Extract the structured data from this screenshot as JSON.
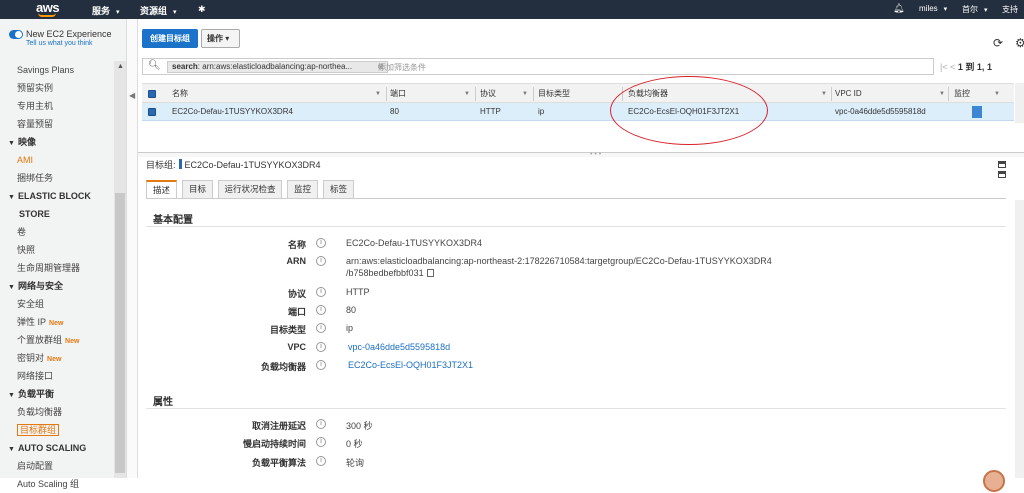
{
  "topnav": {
    "logo": "aws",
    "services": "服务",
    "resource_groups": "资源组",
    "user": "miles",
    "region": "首尔",
    "support": "支持"
  },
  "sidebar": {
    "new_experience_label": "New EC2 Experience",
    "new_experience_sub": "Tell us what you think",
    "items": [
      {
        "label": "Savings Plans"
      },
      {
        "label": "预留实例"
      },
      {
        "label": "专用主机"
      },
      {
        "label": "容量预留"
      },
      {
        "label": "映像",
        "head": true
      },
      {
        "label": "AMI"
      },
      {
        "label": "捆绑任务"
      },
      {
        "label": "ELASTIC BLOCK",
        "head": true
      },
      {
        "label": "STORE",
        "head_cont": true
      },
      {
        "label": "卷"
      },
      {
        "label": "快照"
      },
      {
        "label": "生命周期管理器"
      },
      {
        "label": "网络与安全",
        "head": true
      },
      {
        "label": "安全组"
      },
      {
        "label": "弹性 IP",
        "badge": "New"
      },
      {
        "label": "个置放群组",
        "badge": "New"
      },
      {
        "label": "密钥对",
        "badge": "New"
      },
      {
        "label": "网络接口"
      },
      {
        "label": "负载平衡",
        "head": true
      },
      {
        "label": "负载均衡器"
      },
      {
        "label": "目标群组",
        "active": true
      },
      {
        "label": "AUTO SCALING",
        "head": true
      },
      {
        "label": "启动配置"
      },
      {
        "label": "Auto Scaling 组"
      }
    ]
  },
  "toolbar": {
    "create_label": "创建目标组",
    "actions_label": "操作"
  },
  "search": {
    "chip_key": "search",
    "chip_value": ": arn:aws:elasticloadbalancing:ap-northea...",
    "placeholder": "添加筛选条件"
  },
  "pager": {
    "range": "1 到 1",
    "total": "1"
  },
  "table": {
    "columns": [
      "名称",
      "端口",
      "协议",
      "目标类型",
      "负载均衡器",
      "VPC ID",
      "监控"
    ],
    "rows": [
      {
        "name": "EC2Co-Defau-1TUSYYKOX3DR4",
        "port": "80",
        "protocol": "HTTP",
        "target_type": "ip",
        "load_balancer": "EC2Co-EcsEl-OQH01F3JT2X1",
        "vpc_id": "vpc-0a46dde5d5595818d"
      }
    ]
  },
  "detail": {
    "title_prefix": "目标组:",
    "title_name": "EC2Co-Defau-1TUSYYKOX3DR4",
    "tabs": [
      "描述",
      "目标",
      "运行状况检查",
      "监控",
      "标签"
    ],
    "basic_section": "基本配置",
    "fields": {
      "name_label": "名称",
      "name_value": "EC2Co-Defau-1TUSYYKOX3DR4",
      "arn_label": "ARN",
      "arn_value_1": "arn:aws:elasticloadbalancing:ap-northeast-2:178226710584:targetgroup/EC2Co-Defau-1TUSYYKOX3DR4",
      "arn_value_2": "/b758bedbefbbf031",
      "protocol_label": "协议",
      "protocol_value": "HTTP",
      "port_label": "端口",
      "port_value": "80",
      "target_type_label": "目标类型",
      "target_type_value": "ip",
      "vpc_label": "VPC",
      "vpc_value": "vpc-0a46dde5d5595818d",
      "lb_label": "负载均衡器",
      "lb_value": "EC2Co-EcsEl-OQH01F3JT2X1"
    },
    "attr_section": "属性",
    "attrs": {
      "dereg_label": "取消注册延迟",
      "dereg_value": "300 秒",
      "slow_label": "慢启动持续时间",
      "slow_value": "0 秒",
      "algo_label": "负载平衡算法",
      "algo_value": "轮询"
    }
  },
  "colors": {
    "nav_bg": "#232f3e",
    "primary": "#1a73c9",
    "accent": "#e47911",
    "annotation": "#d7232a"
  }
}
